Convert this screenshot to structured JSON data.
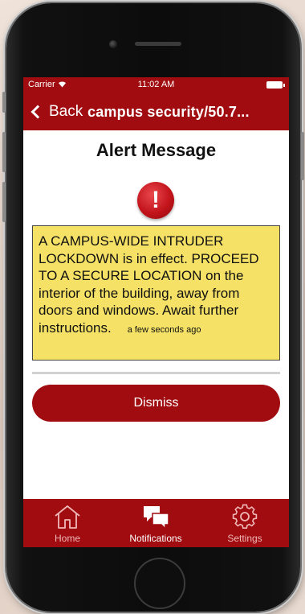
{
  "status_bar": {
    "carrier": "Carrier",
    "time": "11:02 AM"
  },
  "nav": {
    "back_label": "Back",
    "title": "campus security/50.7..."
  },
  "page": {
    "title": "Alert Message",
    "alert_icon_glyph": "!"
  },
  "message": {
    "text": "A CAMPUS-WIDE INTRUDER LOCKDOWN is in effect. PROCEED TO A SECURE LOCATION on the interior of the building, away from doors and windows. Await further instructions.",
    "time": "a few seconds ago"
  },
  "dismiss_label": "Dismiss",
  "tabs": [
    {
      "label": "Home",
      "icon": "home-icon",
      "active": false
    },
    {
      "label": "Notifications",
      "icon": "notifications-icon",
      "active": true
    },
    {
      "label": "Settings",
      "icon": "settings-icon",
      "active": false
    }
  ],
  "colors": {
    "brand": "#a00c10",
    "message_background": "#f4e165",
    "alert_icon": "#c3141b"
  }
}
